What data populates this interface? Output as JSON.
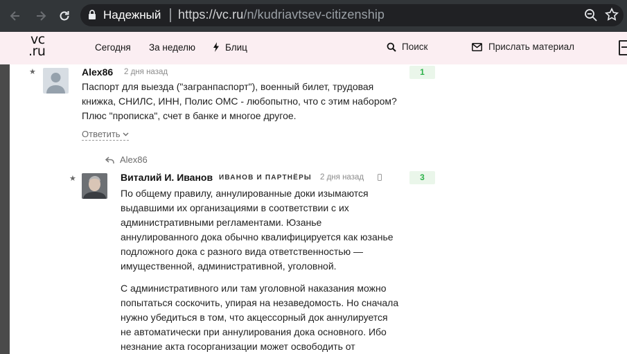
{
  "browser": {
    "secure_label": "Надежный",
    "url_host": "https://vc.ru",
    "url_path": "/n/kudriavtsev-citizenship"
  },
  "site": {
    "logo_top": "vc",
    "logo_bottom": ".ru",
    "nav": {
      "today": "Сегодня",
      "week": "За неделю",
      "blitz": "Блиц",
      "search": "Поиск",
      "send": "Прислать материал"
    }
  },
  "comments": [
    {
      "author": "Alex86",
      "time": "2 дня назад",
      "rating": "1",
      "text": [
        "Паспорт для выезда (\"загранпаспорт\"), военный билет, трудовая",
        "книжка, СНИЛС, ИНН, Полис ОМС - любопытно, что с этим набором?",
        "Плюс \"прописка\", счет в банке и многое другое."
      ],
      "reply_label": "Ответить"
    },
    {
      "reply_to": "Alex86",
      "author": "Виталий И. Иванов",
      "company": "ИВАНОВ И ПАРТНЁРЫ",
      "time": "2 дня назад",
      "rating": "3",
      "paragraph1": [
        "По общему правилу, аннулированные доки изымаются",
        "выдавшими их организациями в соответствии с их",
        "административными регламентами. Юзанье",
        "аннулированного дока обычно квалифицируется как юзанье",
        "подложного дока с разного вида ответственностью —",
        "имущественной, административной, уголовной."
      ],
      "paragraph2": [
        "С административного или там уголовной наказания можно",
        "попытаться соскочить, упирая на незаведомость. Но сначала",
        "нужно убедиться в том, что акцессорный док аннулируется",
        "не автоматически при аннулирования дока основного. Ибо",
        "незнание акта госорганизации может освободить от"
      ]
    }
  ]
}
